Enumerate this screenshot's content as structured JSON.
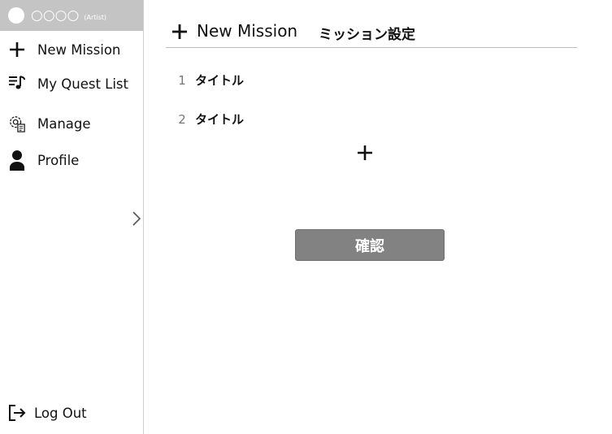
{
  "user": {
    "name": "○○○○",
    "role": "(Artist)"
  },
  "sidebar": {
    "items": [
      {
        "label": "New Mission",
        "icon": "plus-icon"
      },
      {
        "label": "My Quest List",
        "icon": "playlist-icon"
      },
      {
        "label": "Manage",
        "icon": "settings-document-icon"
      },
      {
        "label": "Profile",
        "icon": "person-icon"
      }
    ],
    "logout_label": "Log Out",
    "collapse_icon": "chevron-right-icon"
  },
  "header": {
    "title": "New Mission",
    "subtitle": "ミッション設定"
  },
  "missions": [
    {
      "number": "1",
      "title": "タイトル"
    },
    {
      "number": "2",
      "title": "タイトル"
    }
  ],
  "confirm_label": "確認",
  "colors": {
    "user_bar": "#c4c4c4",
    "confirm_button": "#828282",
    "divider": "#bdbdbd"
  }
}
